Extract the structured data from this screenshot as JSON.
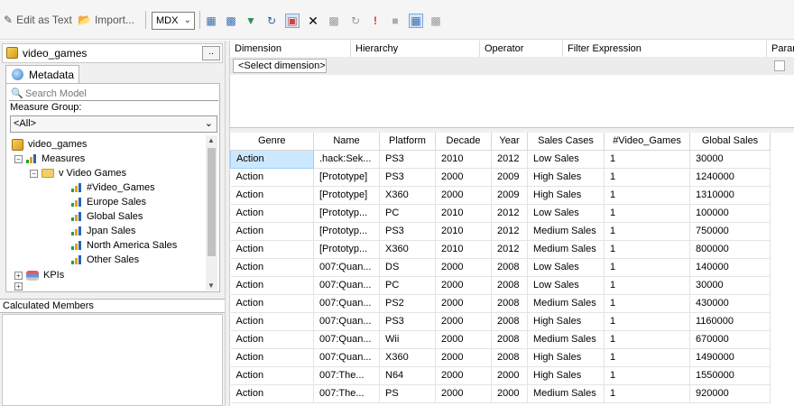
{
  "toolbar": {
    "edit_as_text": "Edit as Text",
    "import": "Import...",
    "query_language": "MDX",
    "icons": [
      "add-calculated-member-icon",
      "show-empty-cells-icon",
      "auto-execute-icon",
      "refresh-icon",
      "design-mode-icon",
      "delete-icon",
      "cancel-query-icon",
      "execute-icon",
      "stop-icon",
      "show-aggregations-icon",
      "query-parameters-icon"
    ]
  },
  "metadata_panel": {
    "cube_name": "video_games",
    "browse_button": "..",
    "tab_label": "Metadata",
    "search_placeholder": "Search Model",
    "measure_group_label": "Measure Group:",
    "measure_group_value": "<All>",
    "tree": {
      "root": "video_games",
      "measures": "Measures",
      "folder": "v Video Games",
      "items": [
        "#Video_Games",
        "Europe Sales",
        "Global Sales",
        "Jpan Sales",
        "North America Sales",
        "Other Sales"
      ],
      "kpis": "KPIs"
    }
  },
  "calculated_members": {
    "label": "Calculated Members"
  },
  "filter": {
    "headers": [
      "Dimension",
      "Hierarchy",
      "Operator",
      "Filter Expression",
      "Param"
    ],
    "select_dimension": "<Select dimension>"
  },
  "results": {
    "columns": [
      "Genre",
      "Name",
      "Platform",
      "Decade",
      "Year",
      "Sales Cases",
      "#Video_Games",
      "Global Sales"
    ],
    "rows": [
      [
        "Action",
        ".hack:Sek...",
        "PS3",
        "2010",
        "2012",
        "Low Sales",
        "1",
        "30000"
      ],
      [
        "Action",
        "[Prototype]",
        "PS3",
        "2000",
        "2009",
        "High Sales",
        "1",
        "1240000"
      ],
      [
        "Action",
        "[Prototype]",
        "X360",
        "2000",
        "2009",
        "High Sales",
        "1",
        "1310000"
      ],
      [
        "Action",
        "[Prototyp...",
        "PC",
        "2010",
        "2012",
        "Low Sales",
        "1",
        "100000"
      ],
      [
        "Action",
        "[Prototyp...",
        "PS3",
        "2010",
        "2012",
        "Medium Sales",
        "1",
        "750000"
      ],
      [
        "Action",
        "[Prototyp...",
        "X360",
        "2010",
        "2012",
        "Medium Sales",
        "1",
        "800000"
      ],
      [
        "Action",
        "007:Quan...",
        "DS",
        "2000",
        "2008",
        "Low Sales",
        "1",
        "140000"
      ],
      [
        "Action",
        "007:Quan...",
        "PC",
        "2000",
        "2008",
        "Low Sales",
        "1",
        "30000"
      ],
      [
        "Action",
        "007:Quan...",
        "PS2",
        "2000",
        "2008",
        "Medium Sales",
        "1",
        "430000"
      ],
      [
        "Action",
        "007:Quan...",
        "PS3",
        "2000",
        "2008",
        "High Sales",
        "1",
        "1160000"
      ],
      [
        "Action",
        "007:Quan...",
        "Wii",
        "2000",
        "2008",
        "Medium Sales",
        "1",
        "670000"
      ],
      [
        "Action",
        "007:Quan...",
        "X360",
        "2000",
        "2008",
        "High Sales",
        "1",
        "1490000"
      ],
      [
        "Action",
        "007:The...",
        "N64",
        "2000",
        "2000",
        "High Sales",
        "1",
        "1550000"
      ],
      [
        "Action",
        "007:The...",
        "PS",
        "2000",
        "2000",
        "Medium Sales",
        "1",
        "920000"
      ]
    ]
  }
}
